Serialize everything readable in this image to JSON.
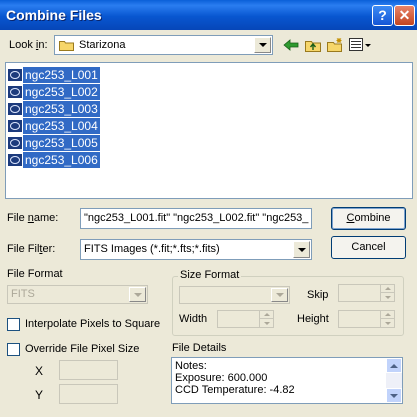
{
  "window": {
    "title": "Combine Files",
    "help_glyph": "?",
    "close_glyph": "✕"
  },
  "look_in": {
    "label_pre": "Look ",
    "label_key": "i",
    "label_post": "n:",
    "value": "Starizona"
  },
  "files": [
    {
      "name": "ngc253_L001"
    },
    {
      "name": "ngc253_L002"
    },
    {
      "name": "ngc253_L003"
    },
    {
      "name": "ngc253_L004"
    },
    {
      "name": "ngc253_L005"
    },
    {
      "name": "ngc253_L006"
    }
  ],
  "file_name": {
    "label_pre": "File ",
    "label_key": "n",
    "label_post": "ame:",
    "value": "\"ngc253_L001.fit\" \"ngc253_L002.fit\" \"ngc253_"
  },
  "file_filter": {
    "label_pre": "File Fil",
    "label_key": "t",
    "label_post": "er:",
    "value": "FITS Images (*.fit;*.fts;*.fits)"
  },
  "buttons": {
    "combine_key": "C",
    "combine_rest": "ombine",
    "cancel": "Cancel"
  },
  "file_format": {
    "label": "File Format",
    "value": "FITS"
  },
  "size_format": {
    "label": "Size Format",
    "skip": "Skip",
    "width": "Width",
    "height": "Height"
  },
  "options": {
    "interpolate": "Interpolate Pixels to Square",
    "override": "Override File Pixel Size",
    "x": "X",
    "y": "Y"
  },
  "details": {
    "label": "File Details",
    "text": "Notes:\nExposure: 600.000\nCCD Temperature: -4.82"
  },
  "colors": {
    "title_bar": "#0a5fd8",
    "selection": "#316ac5",
    "dialog_bg": "#ece9d8"
  },
  "icons": [
    "folder-icon",
    "back-arrow-icon",
    "up-folder-icon",
    "new-folder-icon",
    "view-menu-icon",
    "fits-file-icon"
  ]
}
